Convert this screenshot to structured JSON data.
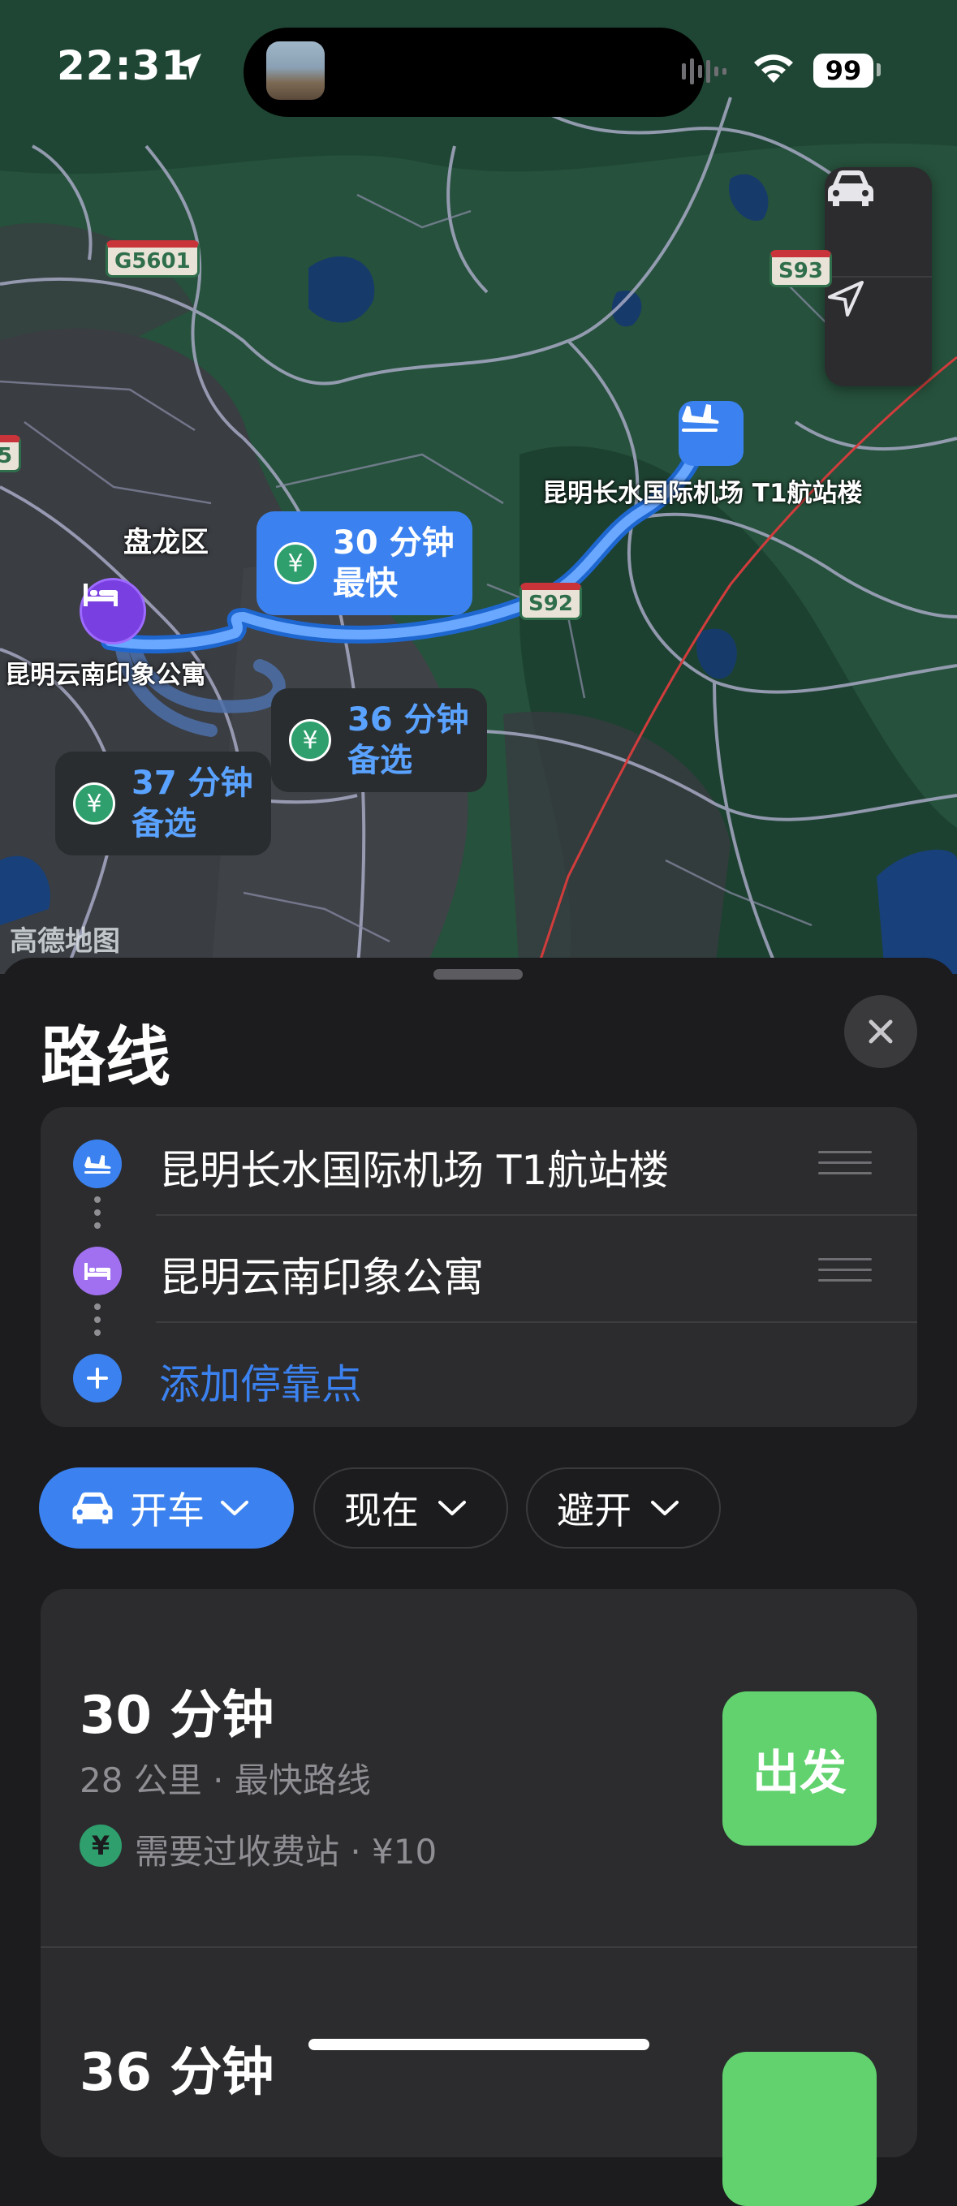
{
  "status_bar": {
    "time": "22:31",
    "battery": "99"
  },
  "map": {
    "labels": {
      "airport": "昆明长水国际机场 T1航站楼",
      "district": "盘龙区",
      "hotel": "昆明云南印象公寓",
      "logo": "高德地图"
    },
    "shields": {
      "g5601": "G5601",
      "s92": "S92",
      "s93": "S93",
      "edge": "5"
    },
    "route_bubbles": [
      {
        "time": "30 分钟",
        "tag": "最快"
      },
      {
        "time": "36 分钟",
        "tag": "备选"
      },
      {
        "time": "37 分钟",
        "tag": "备选"
      }
    ],
    "yen_symbol": "¥"
  },
  "sheet": {
    "title": "路线",
    "stops": [
      {
        "label": "昆明长水国际机场 T1航站楼",
        "icon": "plane-icon",
        "color": "#3b82f0"
      },
      {
        "label": "昆明云南印象公寓",
        "icon": "bed-icon",
        "color": "#a070f0"
      }
    ],
    "add_stop": "添加停靠点",
    "filters": {
      "mode": "开车",
      "time": "现在",
      "avoid": "避开"
    },
    "routes": [
      {
        "time": "30 分钟",
        "detail": "28 公里 · 最快路线",
        "toll": "需要过收费站 · ¥10",
        "go": "出发"
      },
      {
        "time": "36 分钟"
      }
    ]
  },
  "colors": {
    "accent": "#3b82f0",
    "go": "#62d26f",
    "toll": "#2e9f6d"
  }
}
